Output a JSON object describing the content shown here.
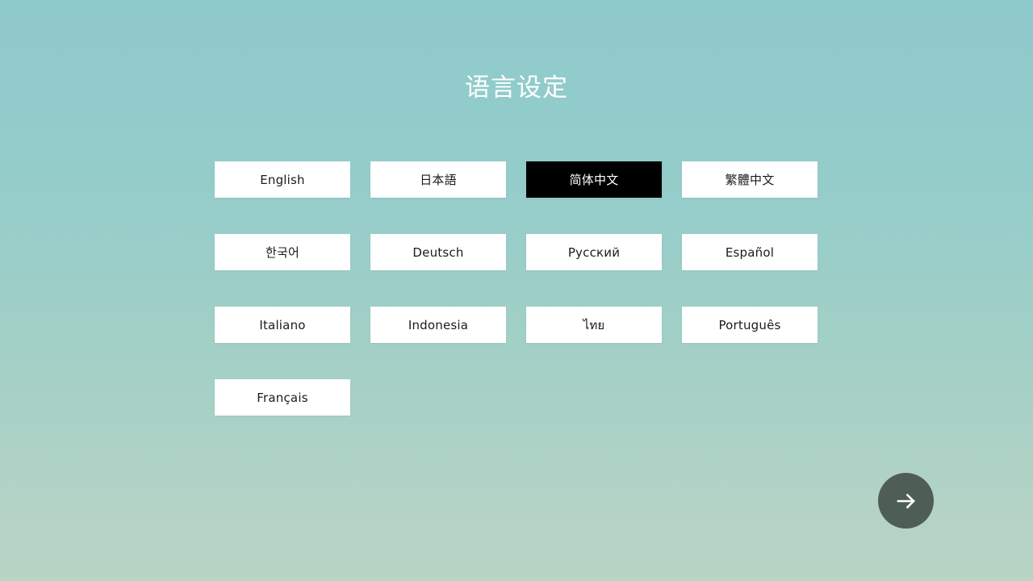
{
  "screen": {
    "name": "language-setting-screen",
    "title": "语言设定",
    "background_top_color": "#8fcacc",
    "background_bottom_color": "#b7d4c4"
  },
  "languages": {
    "selected": "简体中文",
    "selected_bg_color": "#000000",
    "selected_text_color": "#ffffff",
    "item_bg_color": "#ffffff",
    "item_text_color": "#1b1b1b",
    "items": [
      {
        "label": "English",
        "selected": false
      },
      {
        "label": "日本語",
        "selected": false
      },
      {
        "label": "简体中文",
        "selected": true
      },
      {
        "label": "繁體中文",
        "selected": false
      },
      {
        "label": "한국어",
        "selected": false
      },
      {
        "label": "Deutsch",
        "selected": false
      },
      {
        "label": "Русский",
        "selected": false
      },
      {
        "label": "Español",
        "selected": false
      },
      {
        "label": "Italiano",
        "selected": false
      },
      {
        "label": "Indonesia",
        "selected": false
      },
      {
        "label": "ไทย",
        "selected": false
      },
      {
        "label": "Português",
        "selected": false
      },
      {
        "label": "Français",
        "selected": false
      }
    ]
  },
  "next_button": {
    "icon": "arrow-right-icon",
    "bg_color": "#4e5e56",
    "icon_color": "#ffffff"
  }
}
